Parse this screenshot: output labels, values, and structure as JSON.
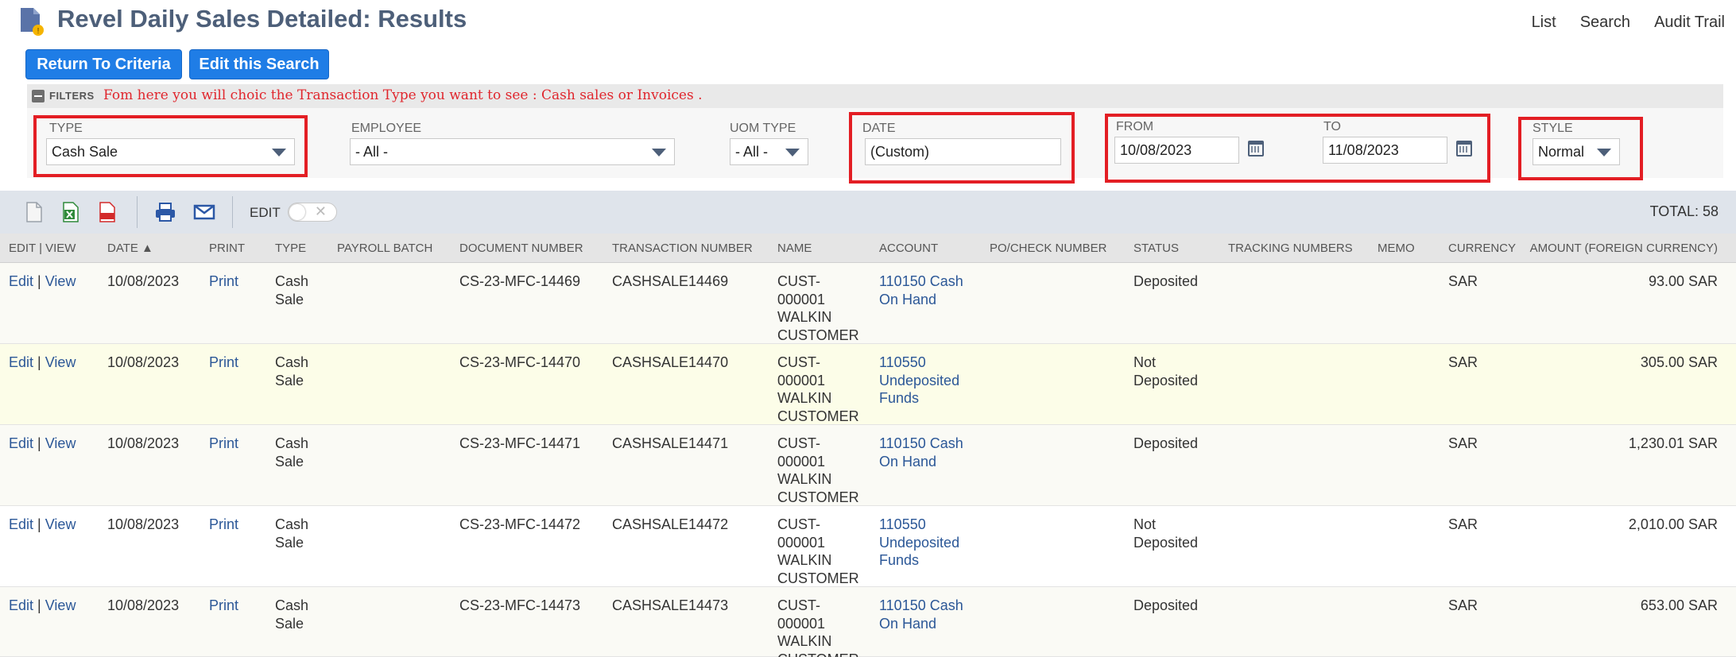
{
  "page": {
    "title": "Revel Daily Sales Detailed: Results"
  },
  "top_links": [
    "List",
    "Search",
    "Audit Trail"
  ],
  "buttons": {
    "return": "Return To Criteria",
    "edit_search": "Edit this Search"
  },
  "filters": {
    "label": "FILTERS",
    "note": "Fom here you will choic the Transaction Type you want to see : Cash sales or Invoices .",
    "type": {
      "label": "TYPE",
      "value": "Cash Sale"
    },
    "employee": {
      "label": "EMPLOYEE",
      "value": "- All -"
    },
    "uom_type": {
      "label": "UOM TYPE",
      "value": "- All -"
    },
    "date": {
      "label": "DATE",
      "value": "(Custom)"
    },
    "from": {
      "label": "FROM",
      "value": "10/08/2023"
    },
    "to": {
      "label": "TO",
      "value": "11/08/2023"
    },
    "style": {
      "label": "STYLE",
      "value": "Normal"
    },
    "highlight_color": "#e31e24"
  },
  "toolbar": {
    "icons": [
      "document-icon",
      "excel-icon",
      "pdf-icon",
      "print-icon",
      "email-icon"
    ],
    "edit_label": "EDIT",
    "total": "TOTAL: 58"
  },
  "table": {
    "headers": [
      "EDIT | VIEW",
      "DATE ▲",
      "PRINT",
      "TYPE",
      "PAYROLL BATCH",
      "DOCUMENT NUMBER",
      "TRANSACTION NUMBER",
      "NAME",
      "ACCOUNT",
      "PO/CHECK NUMBER",
      "STATUS",
      "TRACKING NUMBERS",
      "MEMO",
      "CURRENCY",
      "AMOUNT (FOREIGN CURRENCY)"
    ],
    "edit_text": "Edit",
    "view_text": "View",
    "sep_text": "|",
    "print_text": "Print",
    "rows": [
      {
        "date": "10/08/2023",
        "type": "Cash Sale",
        "doc": "CS-23-MFC-14469",
        "txn": "CASHSALE14469",
        "name": "CUST-000001 WALKIN CUSTOMER",
        "account": "110150 Cash On Hand",
        "status": "Deposited",
        "currency": "SAR",
        "amount": "93.00 SAR"
      },
      {
        "date": "10/08/2023",
        "type": "Cash Sale",
        "doc": "CS-23-MFC-14470",
        "txn": "CASHSALE14470",
        "name": "CUST-000001 WALKIN CUSTOMER",
        "account": "110550 Undeposited Funds",
        "status": "Not Deposited",
        "currency": "SAR",
        "amount": "305.00 SAR"
      },
      {
        "date": "10/08/2023",
        "type": "Cash Sale",
        "doc": "CS-23-MFC-14471",
        "txn": "CASHSALE14471",
        "name": "CUST-000001 WALKIN CUSTOMER",
        "account": "110150 Cash On Hand",
        "status": "Deposited",
        "currency": "SAR",
        "amount": "1,230.01 SAR"
      },
      {
        "date": "10/08/2023",
        "type": "Cash Sale",
        "doc": "CS-23-MFC-14472",
        "txn": "CASHSALE14472",
        "name": "CUST-000001 WALKIN CUSTOMER",
        "account": "110550 Undeposited Funds",
        "status": "Not Deposited",
        "currency": "SAR",
        "amount": "2,010.00 SAR"
      },
      {
        "date": "10/08/2023",
        "type": "Cash Sale",
        "doc": "CS-23-MFC-14473",
        "txn": "CASHSALE14473",
        "name": "CUST-000001 WALKIN CUSTOMER",
        "account": "110150 Cash On Hand",
        "status": "Deposited",
        "currency": "SAR",
        "amount": "653.00 SAR"
      }
    ]
  }
}
